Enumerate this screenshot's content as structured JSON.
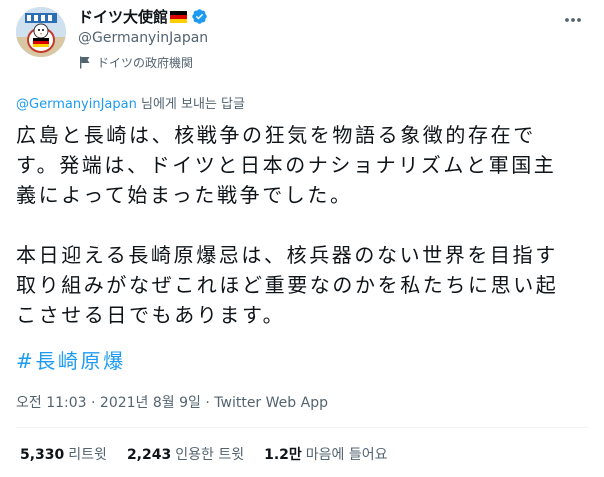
{
  "author": {
    "display_name": "ドイツ大使館",
    "handle": "@GermanyinJapan",
    "gov_label": "ドイツの政府機関",
    "flag_colors": [
      "#000000",
      "#dd0000",
      "#ffce00"
    ],
    "verified_color": "#1d9bf0"
  },
  "reply_context": {
    "mention": "@GermanyinJapan",
    "suffix": " 님에게 보내는 답글"
  },
  "tweet": {
    "lines": [
      "広島と長崎は、核戦争の狂気を物語る象徴的存在で",
      "す。発端は、ドイツと日本のナショナリズムと軍国主",
      "義によって始まった戦争でした。",
      "本日迎える長崎原爆忌は、核兵器のない世界を目指す",
      "取り組みがなぜこれほど重要なのかを私たちに思い起",
      "こさせる日でもあります。"
    ],
    "hashtag": "#長崎原爆"
  },
  "meta": {
    "time": "오전 11:03",
    "separator": " · ",
    "date": "2021년 8월 9일",
    "source": "Twitter Web App"
  },
  "stats": {
    "retweets": {
      "count": "5,330",
      "label": "리트윗"
    },
    "quotes": {
      "count": "2,243",
      "label": "인용한 트윗"
    },
    "likes": {
      "count": "1.2만",
      "label": "마음에 들어요"
    }
  },
  "colors": {
    "accent": "#1d9bf0",
    "secondary_text": "#536471",
    "primary_text": "#0f1419",
    "divider": "#eff3f4"
  }
}
